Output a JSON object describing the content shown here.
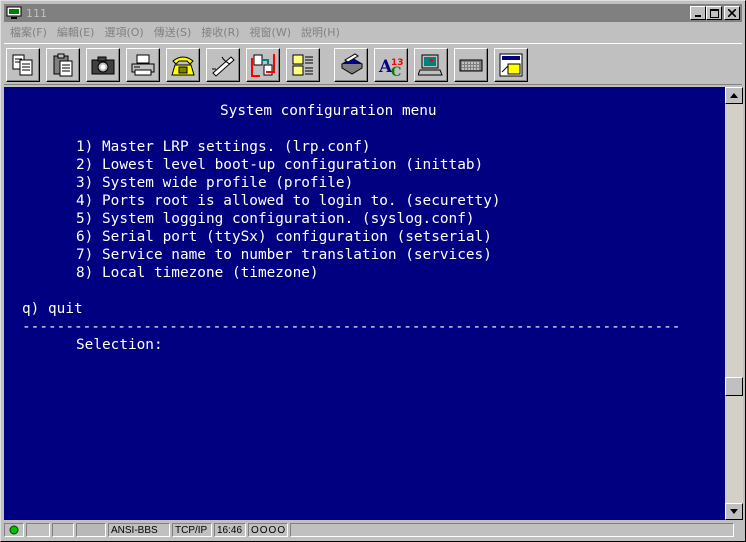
{
  "window": {
    "title": "111"
  },
  "menu": [
    {
      "label": "檔案(F)"
    },
    {
      "label": "編輯(E)"
    },
    {
      "label": "選項(O)"
    },
    {
      "label": "傳送(S)"
    },
    {
      "label": "接收(R)"
    },
    {
      "label": "視窗(W)"
    },
    {
      "label": "說明(H)"
    }
  ],
  "toolbar": [
    {
      "icon": "copy-icon"
    },
    {
      "icon": "paste-icon"
    },
    {
      "icon": "camera-icon"
    },
    {
      "icon": "print-icon"
    },
    {
      "icon": "phone-dial-icon"
    },
    {
      "icon": "hangup-icon"
    },
    {
      "icon": "transfer-icon"
    },
    {
      "icon": "capture-log-icon"
    },
    {
      "icon": "batch-icon"
    },
    {
      "icon": "font-icon"
    },
    {
      "icon": "terminal-icon"
    },
    {
      "icon": "keyboard-icon"
    },
    {
      "icon": "settings-icon"
    }
  ],
  "terminal": {
    "heading": "System configuration menu",
    "items": [
      "1) Master LRP settings. (lrp.conf)",
      "2) Lowest level boot-up configuration (inittab)",
      "3) System wide profile (profile)",
      "4) Ports root is allowed to login to. (securetty)",
      "5) System logging configuration. (syslog.conf)",
      "6) Serial port (ttySx) configuration (setserial)",
      "7) Service name to number translation (services)",
      "8) Local timezone (timezone)"
    ],
    "quit": "q) quit",
    "divider": "----------------------------------------------------------------------------",
    "prompt": "Selection:"
  },
  "status": {
    "emulation": "ANSI-BBS",
    "protocol": "TCP/IP",
    "time": "16:46",
    "lights": "OOOO"
  },
  "colors": {
    "terminal_bg": "#000080",
    "terminal_fg": "#ffffff",
    "status_led": "#00c000"
  }
}
